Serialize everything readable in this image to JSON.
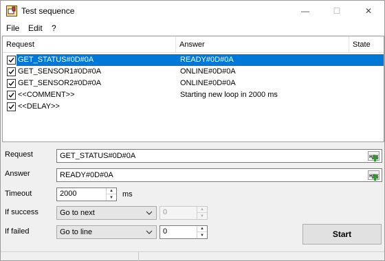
{
  "window": {
    "title": "Test sequence",
    "icon": "app-icon"
  },
  "titlebar_buttons": {
    "minimize": "—",
    "maximize": "☐",
    "close": "✕"
  },
  "menu": [
    "File",
    "Edit",
    "?"
  ],
  "list": {
    "columns": [
      "Request",
      "Answer",
      "State"
    ],
    "rows": [
      {
        "checked": true,
        "request": "GET_STATUS#0D#0A",
        "answer": "READY#0D#0A",
        "state": "",
        "selected": true
      },
      {
        "checked": true,
        "request": "GET_SENSOR1#0D#0A",
        "answer": "ONLINE#0D#0A",
        "state": ""
      },
      {
        "checked": true,
        "request": "GET_SENSOR2#0D#0A",
        "answer": "ONLINE#0D#0A",
        "state": ""
      },
      {
        "checked": true,
        "request": "<<COMMENT>>",
        "answer": "Starting new loop in 2000 ms",
        "state": ""
      },
      {
        "checked": true,
        "request": "<<DELAY>>",
        "answer": "",
        "state": ""
      }
    ]
  },
  "form": {
    "request_label": "Request",
    "request_value": "GET_STATUS#0D#0A",
    "answer_label": "Answer",
    "answer_value": "READY#0D#0A",
    "hex_label": "HEX",
    "timeout_label": "Timeout",
    "timeout_value": "2000",
    "timeout_unit": "ms",
    "success_label": "If success",
    "success_action": "Go to next",
    "success_line": "0",
    "failed_label": "If failed",
    "failed_action": "Go to line",
    "failed_line": "0",
    "start_label": "Start"
  },
  "colors": {
    "selection": "#0078d7",
    "hex_plus": "#2e9a2e"
  }
}
